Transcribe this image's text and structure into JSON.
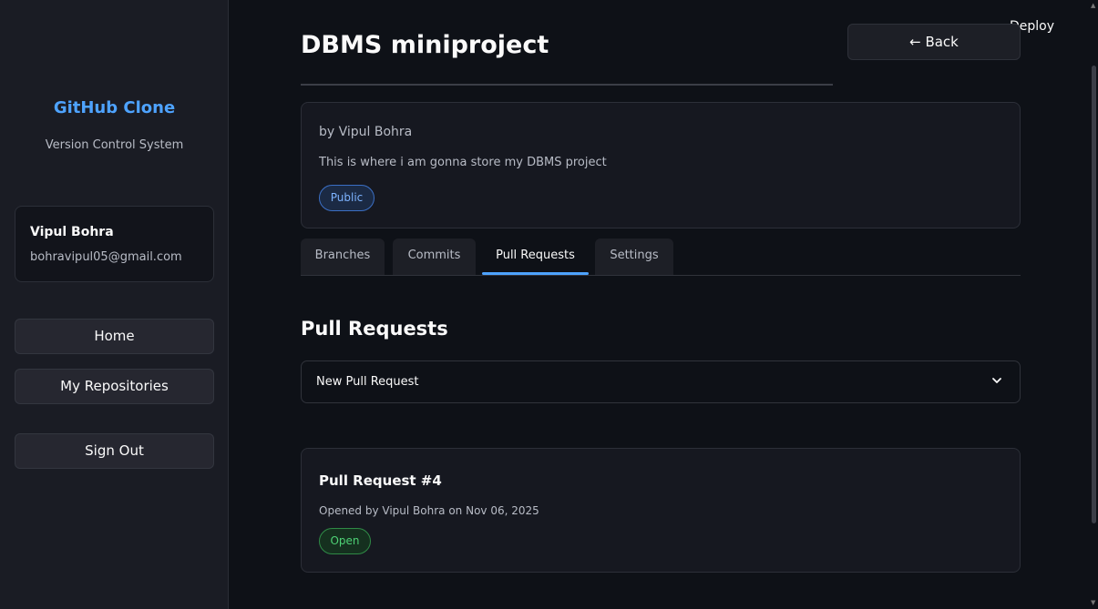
{
  "app": {
    "deploy_label": "Deploy"
  },
  "sidebar": {
    "brand": "GitHub Clone",
    "subtitle": "Version Control System",
    "user": {
      "name": "Vipul Bohra",
      "email": "bohravipul05@gmail.com"
    },
    "nav": [
      {
        "label": "Home"
      },
      {
        "label": "My Repositories"
      },
      {
        "label": "Sign Out"
      }
    ]
  },
  "repo": {
    "title": "DBMS miniproject",
    "back_label": "← Back",
    "owner": "by Vipul Bohra",
    "description": "This is where i am gonna store my DBMS project",
    "visibility": "Public"
  },
  "tabs": [
    {
      "label": "Branches"
    },
    {
      "label": "Commits"
    },
    {
      "label": "Pull Requests",
      "active": true
    },
    {
      "label": "Settings"
    }
  ],
  "pull_requests": {
    "heading": "Pull Requests",
    "new_label": "New Pull Request",
    "items": [
      {
        "title": "Pull Request #4",
        "meta": "Opened by Vipul Bohra on Nov 06, 2025",
        "status": "Open"
      }
    ]
  },
  "colors": {
    "accent": "#4ea3ff",
    "open": "#4ed175",
    "background": "#0e1117"
  }
}
